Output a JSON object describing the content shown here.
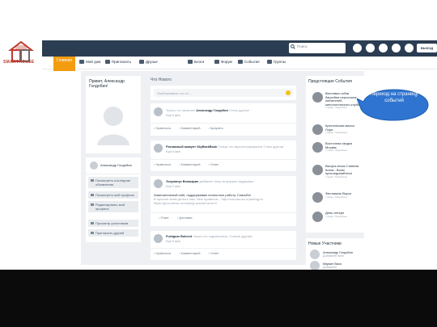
{
  "brand": {
    "logo_text": "SMARTHOUSE"
  },
  "header": {
    "search_placeholder": "Поиск",
    "exit_label": "ВЫХОД"
  },
  "nav": {
    "home_tab": "Главная",
    "items": [
      "Мой дом",
      "Пригласить",
      "Друзья",
      "Блоги",
      "Форум",
      "События",
      "Группы"
    ]
  },
  "profile": {
    "greeting": "Привет, Александр Голдобин!",
    "user_name": "Александр Голдобин",
    "menu": [
      "Посмотреть последние объявления",
      "Посмотреть мой профиль",
      "Редактировать мой профиль",
      "Просмотр участников",
      "Пригласить друзей"
    ]
  },
  "feed": {
    "title": "Что Нового",
    "input_placeholder": "Опубликовать что-то ...",
    "posts": [
      {
        "head_pre": "Только что зачислен",
        "author": "Александр Голдобин",
        "head_post": "Стань другом!",
        "time": "Ещё 8 фев",
        "actions": [
          "Нравиться",
          "Комментарий",
          "Браузеть"
        ]
      },
      {
        "author": "Рекламный аккаунт SkyBackBook",
        "head_post": "Только что зарегистрировался! Стань другом!",
        "time": "Ещё 8 фев",
        "actions": [
          "Нравиться",
          "Комментарий",
          "Ответ"
        ]
      },
      {
        "author": "Эскулапус Волшарин",
        "head_pre_mid": "добавлен тему",
        "head_post": "на форуме поддержки",
        "time": "Ещё 9 фев",
        "body": "Замечательный сайт, поддерживаю полностью работу. Спасибо!",
        "body_sub": "В прологе всем делить нам. Мне нравится... http://ссылка-на-страницу.ru",
        "body_sub2": "https://goro.skhse.ru/catalog-waxherna.html",
        "actions": [
          "Ответ",
          "Доставка"
        ]
      },
      {
        "author": "Fuixiguar Bolcent",
        "head_post": "только что подключился. Станьте другом!",
        "time": "Ещё 8 фев",
        "actions": [
          "Нравиться",
          "Комментарий",
          "Ответ"
        ]
      }
    ]
  },
  "events": {
    "title": "Предстоящие События",
    "items": [
      {
        "name": "Выставка собак бассейна персонала: любителей кинологического клуба",
        "meta": "7 февр. Подробнее"
      },
      {
        "name": "Критическая масса Лори",
        "meta": "7 февр. Подробнее"
      },
      {
        "name": "Восточная скидка Москва",
        "meta": "7 февр. Подробнее"
      },
      {
        "name": "Выпуск книга Стивена Кинга - Всем присоединяйтесь!",
        "meta": "7 февр. Подробнее"
      },
      {
        "name": "Фестиваль Вкуса",
        "meta": "7 февр. Подробнее"
      },
      {
        "name": "День интерн",
        "meta": "7 февр. Подробнее"
      }
    ]
  },
  "members": {
    "title": "Новые Участники",
    "items": [
      {
        "name": "Александр Голдобин",
        "meta": "Добавлен всех"
      },
      {
        "name": "Маркин Вася",
        "meta": "Добавлен"
      }
    ]
  },
  "callout": {
    "text": "Переход на страницу событий"
  },
  "colors": {
    "topbar": "#2b3d52",
    "accent": "#f39c12",
    "callout": "#2f74d0",
    "bottom_band": "#0b0b0b"
  }
}
